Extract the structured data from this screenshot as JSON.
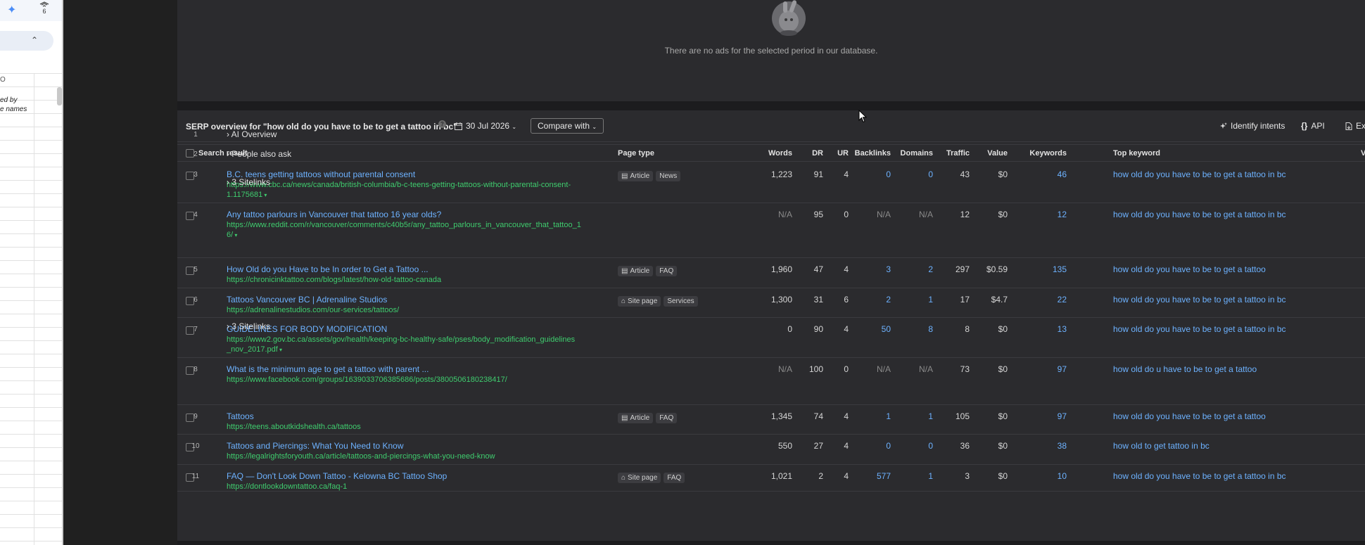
{
  "left_panel": {
    "ext_badge": "6",
    "column_letter": "O",
    "cell_text_1": "ed by",
    "cell_text_2": "e names"
  },
  "ads": {
    "message": "There are no ads for the selected period in our database."
  },
  "serp": {
    "title": "SERP overview for \"how old do you have to be to get a tattoo in bc\"",
    "help_icon": "?",
    "date": "30 Jul 2026",
    "compare_label": "Compare with",
    "identify_label": "Identify intents",
    "api_label": "API",
    "export_label": "Ex",
    "columns": {
      "result": "Search result",
      "page_type": "Page type",
      "words": "Words",
      "dr": "DR",
      "ur": "UR",
      "backlinks": "Backlinks",
      "domains": "Domains",
      "traffic": "Traffic",
      "value": "Value",
      "keywords": "Keywords",
      "top_keyword": "Top keyword",
      "volume": "V"
    },
    "features": [
      {
        "pos": "1",
        "label": "AI Overview"
      },
      {
        "pos": "2",
        "label": "People also ask"
      }
    ],
    "sitelinks_label": "3 Sitelinks",
    "rows": [
      {
        "pos": "3",
        "title": "B.C. teens getting tattoos without parental consent",
        "url_1": "https://www.cbc.ca/news/canada/british-columbia/b-c-teens-getting-tattoos-without-parental-consent-",
        "url_2": "1.1175681",
        "badges": [
          "Article",
          "News"
        ],
        "badge_icon": "article-icon",
        "words": "1,223",
        "dr": "91",
        "ur": "4",
        "backlinks": "0",
        "domains": "0",
        "traffic": "43",
        "value": "$0",
        "keywords": "46",
        "top_keyword": "how old do you have to be to get a tattoo in bc"
      },
      {
        "pos": "4",
        "title": "Any tattoo parlours in Vancouver that tattoo 16 year olds?",
        "url_1": "https://www.reddit.com/r/vancouver/comments/c40b5r/any_tattoo_parlours_in_vancouver_that_tattoo_1",
        "url_2": "6/",
        "badges": [],
        "badge_icon": "",
        "words": "N/A",
        "dr": "95",
        "ur": "0",
        "backlinks": "N/A",
        "domains": "N/A",
        "traffic": "12",
        "value": "$0",
        "keywords": "12",
        "top_keyword": "how old do you have to be to get a tattoo in bc"
      },
      {
        "pos": "5",
        "title": "How Old do you Have to be In order to Get a Tattoo ...",
        "url_1": "https://chronicinktattoo.com/blogs/latest/how-old-tattoo-canada",
        "url_2": "",
        "badges": [
          "Article",
          "FAQ"
        ],
        "badge_icon": "article-icon",
        "words": "1,960",
        "dr": "47",
        "ur": "4",
        "backlinks": "3",
        "domains": "2",
        "traffic": "297",
        "value": "$0.59",
        "keywords": "135",
        "top_keyword": "how old do you have to be to get a tattoo"
      },
      {
        "pos": "6",
        "title": "Tattoos Vancouver BC | Adrenaline Studios",
        "url_1": "https://adrenalinestudios.com/our-services/tattoos/",
        "url_2": "",
        "badges": [
          "Site page",
          "Services"
        ],
        "badge_icon": "home-icon",
        "words": "1,300",
        "dr": "31",
        "ur": "6",
        "backlinks": "2",
        "domains": "1",
        "traffic": "17",
        "value": "$4.7",
        "keywords": "22",
        "top_keyword": "how old do you have to be to get a tattoo in bc"
      },
      {
        "pos": "7",
        "title": "GUIDELINES FOR BODY MODIFICATION",
        "url_1": "https://www2.gov.bc.ca/assets/gov/health/keeping-bc-healthy-safe/pses/body_modification_guidelines",
        "url_2": "_nov_2017.pdf",
        "badges": [],
        "badge_icon": "",
        "words": "0",
        "dr": "90",
        "ur": "4",
        "backlinks": "50",
        "domains": "8",
        "traffic": "8",
        "value": "$0",
        "keywords": "13",
        "top_keyword": "how old do you have to be to get a tattoo in bc"
      },
      {
        "pos": "8",
        "title": "What is the minimum age to get a tattoo with parent ...",
        "url_1": "https://www.facebook.com/groups/1639033706385686/posts/3800506180238417/",
        "url_2": "",
        "badges": [],
        "badge_icon": "",
        "words": "N/A",
        "dr": "100",
        "ur": "0",
        "backlinks": "N/A",
        "domains": "N/A",
        "traffic": "73",
        "value": "$0",
        "keywords": "97",
        "top_keyword": "how old do u have to be to get a tattoo"
      },
      {
        "pos": "9",
        "title": "Tattoos",
        "url_1": "https://teens.aboutkidshealth.ca/tattoos",
        "url_2": "",
        "badges": [
          "Article",
          "FAQ"
        ],
        "badge_icon": "article-icon",
        "words": "1,345",
        "dr": "74",
        "ur": "4",
        "backlinks": "1",
        "domains": "1",
        "traffic": "105",
        "value": "$0",
        "keywords": "97",
        "top_keyword": "how old do you have to be to get a tattoo"
      },
      {
        "pos": "10",
        "title": "Tattoos and Piercings: What You Need to Know",
        "url_1": "https://legalrightsforyouth.ca/article/tattoos-and-piercings-what-you-need-know",
        "url_2": "",
        "badges": [],
        "badge_icon": "",
        "words": "550",
        "dr": "27",
        "ur": "4",
        "backlinks": "0",
        "domains": "0",
        "traffic": "36",
        "value": "$0",
        "keywords": "38",
        "top_keyword": "how old to get tattoo in bc"
      },
      {
        "pos": "11",
        "title": "FAQ — Don't Look Down Tattoo - Kelowna BC Tattoo Shop",
        "url_1": "https://dontlookdowntattoo.ca/faq-1",
        "url_2": "",
        "badges": [
          "Site page",
          "FAQ"
        ],
        "badge_icon": "home-icon",
        "words": "1,021",
        "dr": "2",
        "ur": "4",
        "backlinks": "577",
        "domains": "1",
        "traffic": "3",
        "value": "$0",
        "keywords": "10",
        "top_keyword": "how old do you have to be to get a tattoo in bc"
      }
    ]
  },
  "colors": {
    "link": "#6db2ff",
    "url": "#3fcc6e",
    "panel": "#2b2b2e",
    "background": "#1c1c1e"
  }
}
